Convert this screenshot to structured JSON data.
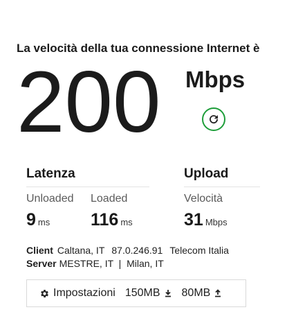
{
  "headline": "La velocità della tua connessione Internet è",
  "speed": {
    "value": "200",
    "unit": "Mbps"
  },
  "latency": {
    "title": "Latenza",
    "unloaded": {
      "label": "Unloaded",
      "value": "9",
      "unit": "ms"
    },
    "loaded": {
      "label": "Loaded",
      "value": "116",
      "unit": "ms"
    }
  },
  "upload": {
    "title": "Upload",
    "velocity": {
      "label": "Velocità",
      "value": "31",
      "unit": "Mbps"
    }
  },
  "client": {
    "label": "Client",
    "location": "Caltana, IT",
    "ip": "87.0.246.91",
    "isp": "Telecom Italia"
  },
  "server": {
    "label": "Server",
    "text": "MESTRE, IT  |  Milan, IT"
  },
  "settings": {
    "label": "Impostazioni",
    "download_size": "150MB",
    "upload_size": "80MB"
  },
  "colors": {
    "refresh_ring": "#1e9e3a"
  },
  "icons": [
    "refresh-icon",
    "gear-icon",
    "download-icon",
    "upload-icon"
  ]
}
